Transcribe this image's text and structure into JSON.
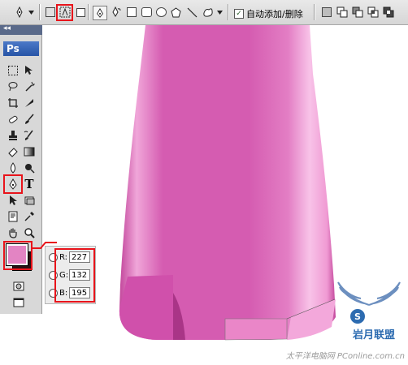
{
  "options_bar": {
    "auto_add_delete_label": "自动添加/删除",
    "auto_add_delete_checked": true
  },
  "toolbox": {
    "app_label": "Ps",
    "grip_label": "◂◂",
    "type_tool_label": "T"
  },
  "colors": {
    "foreground": "#e384c3",
    "background": "#2b0f12",
    "highlight": "#e8141b",
    "bottle_main": "#d961b4",
    "bottle_light": "#f3a8db"
  },
  "rgb_panel": {
    "r_label": "R:",
    "g_label": "G:",
    "b_label": "B:",
    "r_value": "227",
    "g_value": "132",
    "b_value": "195"
  },
  "watermark": {
    "footer_text": "太平洋电脑网 PConline.com.cn",
    "logo_text": "岩月联盟"
  }
}
